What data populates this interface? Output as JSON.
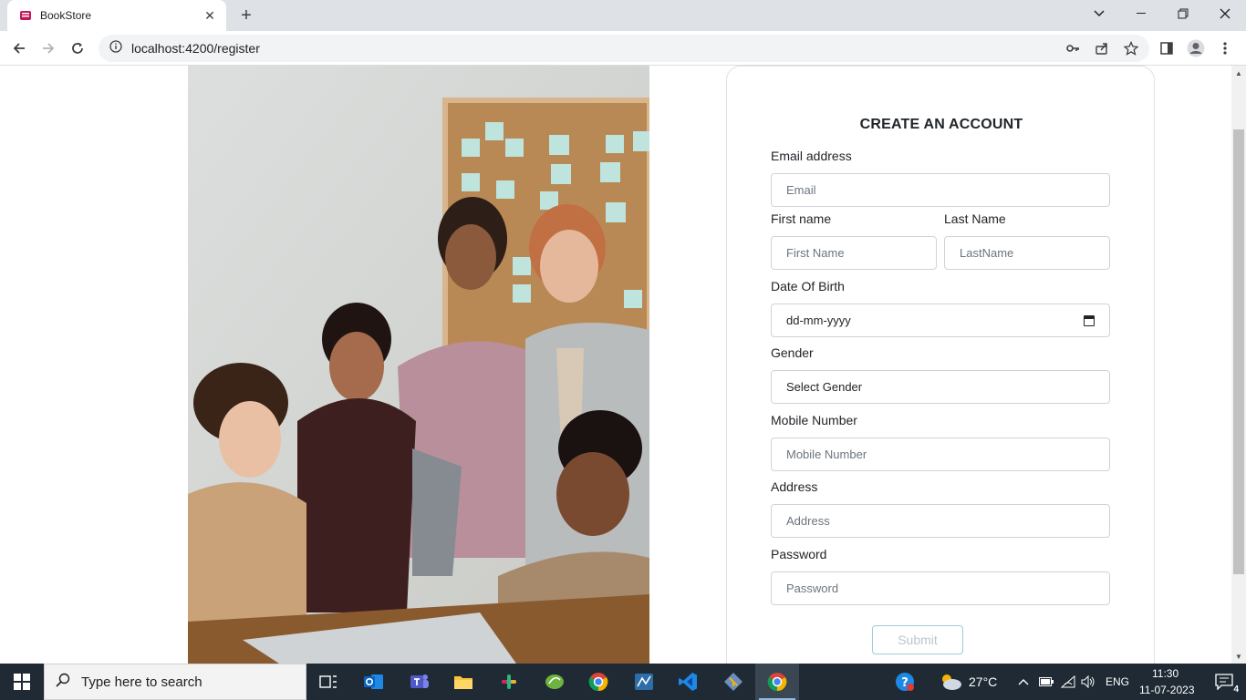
{
  "browser": {
    "tab_title": "BookStore",
    "url": "localhost:4200/register"
  },
  "form": {
    "title": "CREATE AN ACCOUNT",
    "email_label": "Email address",
    "email_placeholder": "Email",
    "first_name_label": "First name",
    "first_name_placeholder": "First Name",
    "last_name_label": "Last Name",
    "last_name_placeholder": "LastName",
    "dob_label": "Date Of Birth",
    "dob_value": "dd-mm-yyyy",
    "gender_label": "Gender",
    "gender_value": "Select Gender",
    "mobile_label": "Mobile Number",
    "mobile_placeholder": "Mobile Number",
    "address_label": "Address",
    "address_placeholder": "Address",
    "password_label": "Password",
    "password_placeholder": "Password",
    "submit_label": "Submit"
  },
  "taskbar": {
    "search_placeholder": "Type here to search",
    "weather": "27°C",
    "language": "ENG",
    "time": "11:30",
    "date": "11-07-2023",
    "notification_count": "4"
  },
  "colors": {
    "accent": "#0078d4",
    "taskbar_bg": "#1f2a34",
    "submit_border": "#9ecbd7"
  }
}
